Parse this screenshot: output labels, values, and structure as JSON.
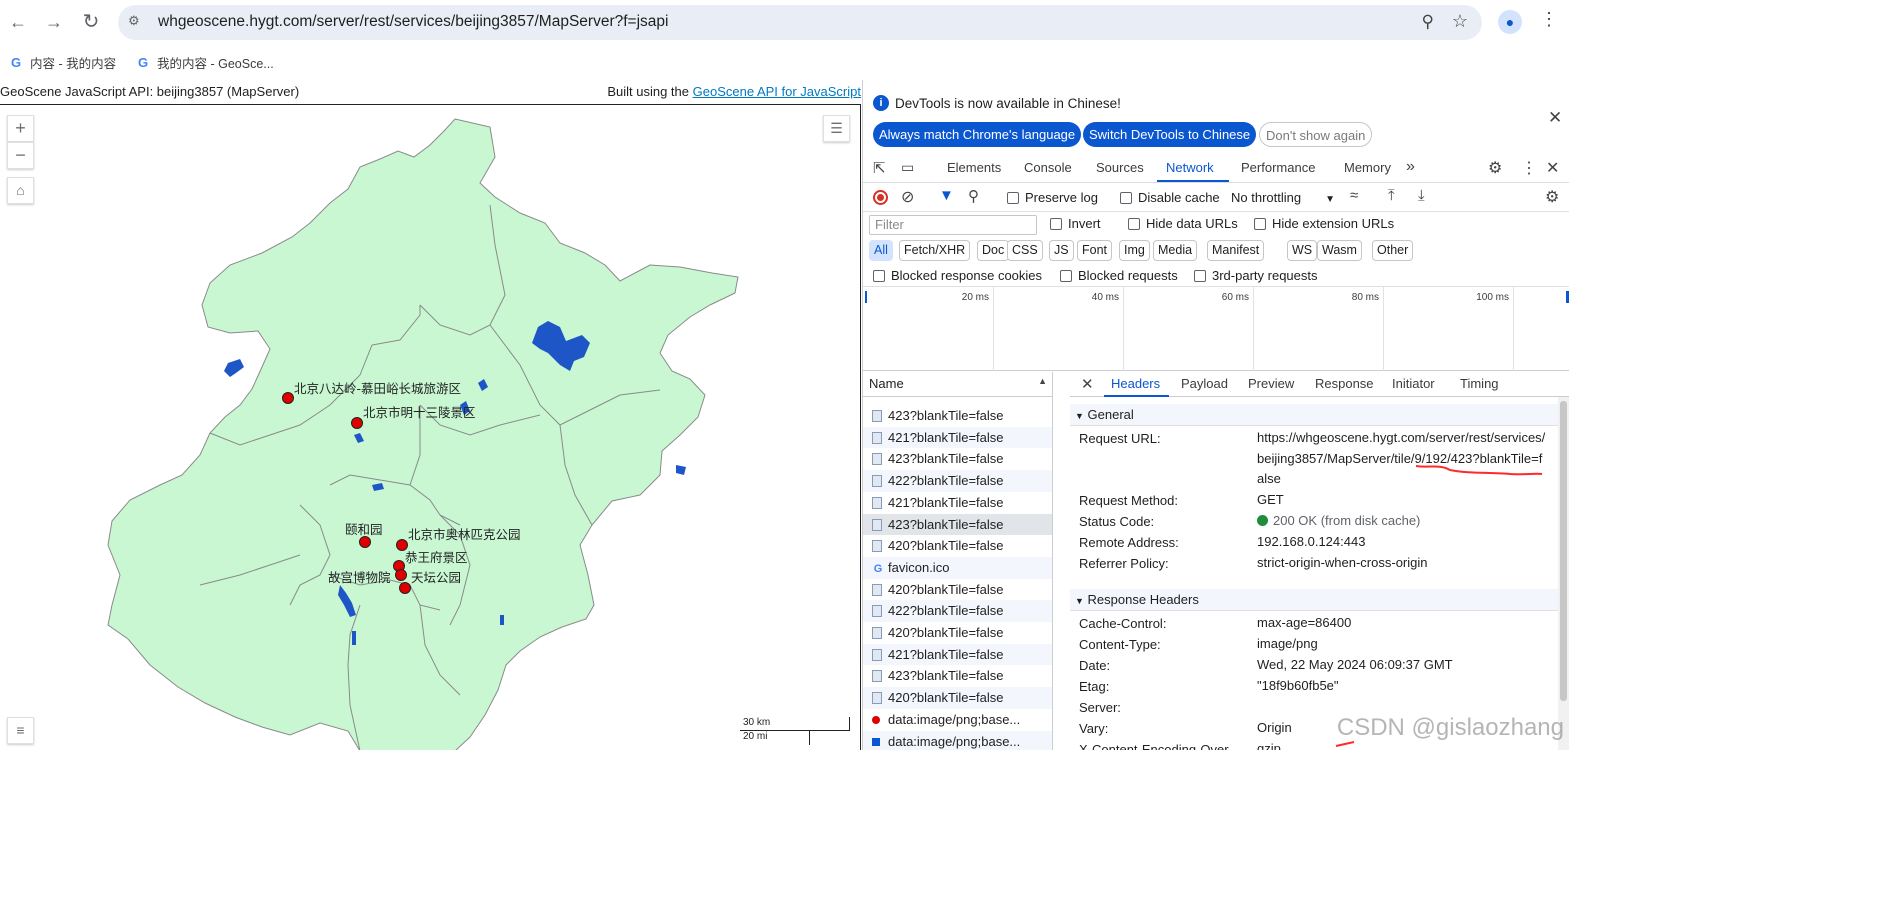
{
  "browser": {
    "url": "whgeoscene.hygt.com/server/rest/services/beijing3857/MapServer?f=jsapi",
    "bookmarks": [
      {
        "label": "内容 - 我的内容"
      },
      {
        "label": "我的内容 - GeoSce..."
      }
    ]
  },
  "page": {
    "title": "GeoScene JavaScript API: beijing3857 (MapServer)",
    "built_prefix": "Built using the ",
    "built_link": "GeoScene API for JavaScript"
  },
  "map": {
    "zoom_in": "+",
    "zoom_out": "−",
    "places": [
      {
        "label": "北京八达岭-慕田峪长城旅游区"
      },
      {
        "label": "北京市明十三陵景区"
      },
      {
        "label": "颐和园"
      },
      {
        "label": "北京市奥林匹克公园"
      },
      {
        "label": "恭王府景区"
      },
      {
        "label": "故宫博物院"
      },
      {
        "label": "天坛公园"
      }
    ],
    "scale_km": "30 km",
    "scale_mi": "20 mi",
    "fill_color": "#c8f7d2",
    "point_color": "#e00000",
    "water_color": "#1e56c8"
  },
  "devtools": {
    "info_text": "DevTools is now available in Chinese!",
    "btn_match": "Always match Chrome's language",
    "btn_switch": "Switch DevTools to Chinese",
    "btn_dont": "Don't show again",
    "tabs": [
      "Elements",
      "Console",
      "Sources",
      "Network",
      "Performance",
      "Memory"
    ],
    "active_tab": "Network",
    "toolbar": {
      "preserve_log": "Preserve log",
      "disable_cache": "Disable cache",
      "throttling": "No throttling"
    },
    "filter_placeholder": "Filter",
    "invert": "Invert",
    "hide_data": "Hide data URLs",
    "hide_ext": "Hide extension URLs",
    "types": [
      "All",
      "Fetch/XHR",
      "Doc",
      "CSS",
      "JS",
      "Font",
      "Img",
      "Media",
      "Manifest",
      "WS",
      "Wasm",
      "Other"
    ],
    "blocked_cookies": "Blocked response cookies",
    "blocked_requests": "Blocked requests",
    "third_party": "3rd-party requests",
    "timeline_ticks": [
      "20 ms",
      "40 ms",
      "60 ms",
      "80 ms",
      "100 ms"
    ],
    "name_header": "Name",
    "requests": [
      "423?blankTile=false",
      "421?blankTile=false",
      "423?blankTile=false",
      "422?blankTile=false",
      "421?blankTile=false",
      "423?blankTile=false",
      "420?blankTile=false",
      "favicon.ico",
      "420?blankTile=false",
      "422?blankTile=false",
      "420?blankTile=false",
      "421?blankTile=false",
      "423?blankTile=false",
      "420?blankTile=false",
      "data:image/png;base...",
      "data:image/png;base..."
    ],
    "detail_tabs": [
      "Headers",
      "Payload",
      "Preview",
      "Response",
      "Initiator",
      "Timing"
    ],
    "general_title": "General",
    "general": [
      {
        "k": "Request URL:",
        "v": "https://whgeoscene.hygt.com/server/rest/services/beijing3857/MapServer/tile/9/192/423?blankTile=false"
      },
      {
        "k": "Request Method:",
        "v": "GET"
      },
      {
        "k": "Status Code:",
        "v": "200 OK (from disk cache)"
      },
      {
        "k": "Remote Address:",
        "v": "192.168.0.124:443"
      },
      {
        "k": "Referrer Policy:",
        "v": "strict-origin-when-cross-origin"
      }
    ],
    "response_title": "Response Headers",
    "response_headers": [
      {
        "k": "Cache-Control:",
        "v": "max-age=86400"
      },
      {
        "k": "Content-Type:",
        "v": "image/png"
      },
      {
        "k": "Date:",
        "v": "Wed, 22 May 2024 06:09:37 GMT"
      },
      {
        "k": "Etag:",
        "v": "\"18f9b60fb5e\""
      },
      {
        "k": "Server:",
        "v": ""
      },
      {
        "k": "Vary:",
        "v": "Origin"
      },
      {
        "k": "X-Content-Encoding-Over-",
        "v": "gzip"
      }
    ],
    "watermark": "CSDN @gislaozhang"
  }
}
